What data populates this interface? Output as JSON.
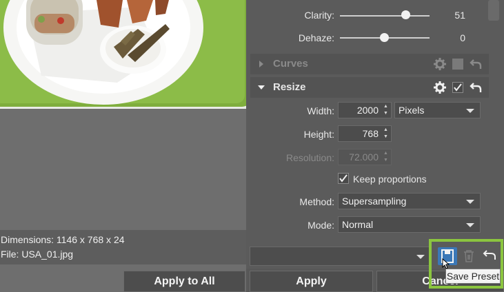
{
  "preview": {
    "dimensions_text": "Dimensions: 1146 x 768 x 24",
    "file_text": "File: USA_01.jpg"
  },
  "panel": {
    "clarity": {
      "label": "Clarity:",
      "value": "51",
      "fraction": 0.78
    },
    "dehaze": {
      "label": "Dehaze:",
      "value": "0",
      "fraction": 0.5
    },
    "curves": {
      "title": "Curves"
    },
    "resize": {
      "title": "Resize",
      "width_label": "Width:",
      "width_value": "2000",
      "unit": "Pixels",
      "height_label": "Height:",
      "height_value": "768",
      "resolution_label": "Resolution:",
      "resolution_value": "72.000",
      "keep_label": "Keep proportions",
      "method_label": "Method:",
      "method_value": "Supersampling",
      "mode_label": "Mode:",
      "mode_value": "Normal"
    }
  },
  "bottom": {
    "apply_all": "Apply to All",
    "apply": "Apply",
    "cancel": "Cancel",
    "tooltip": "Save Preset"
  },
  "colors": {
    "highlight": "#8bc53f",
    "save_active": "#3b78b7"
  }
}
